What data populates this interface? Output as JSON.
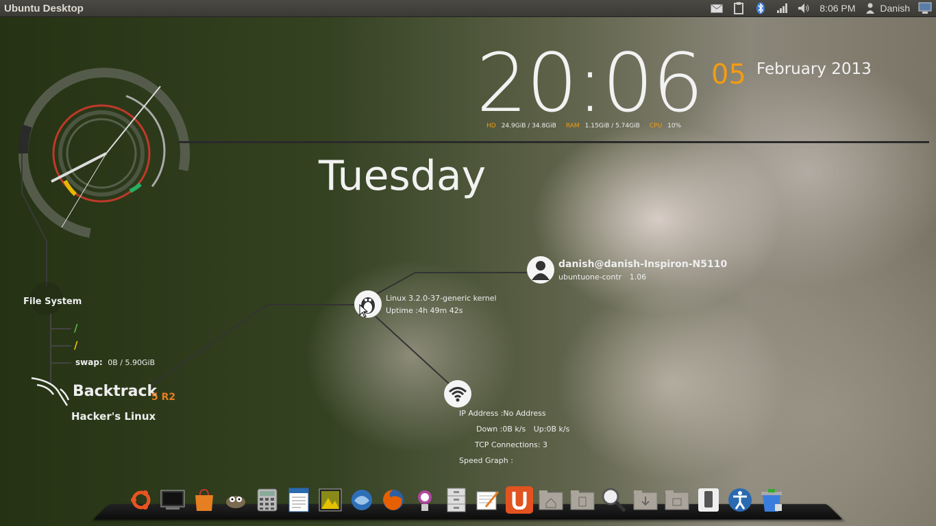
{
  "topbar": {
    "title": "Ubuntu Desktop",
    "time": "8:06 PM",
    "user": "Danish",
    "icons": [
      "mail-icon",
      "clipboard-icon",
      "bluetooth-icon",
      "network-signal-icon",
      "volume-icon",
      "user-icon",
      "system-gear-icon"
    ]
  },
  "clock": {
    "hm": "20:06",
    "seconds": "05",
    "date": "February 2013",
    "day": "Tuesday"
  },
  "stats": {
    "hd_label": "HD",
    "hd_value": "24.9GiB / 34.8GiB",
    "ram_label": "RAM",
    "ram_value": "1.15GiB / 5.74GiB",
    "cpu_label": "CPU",
    "cpu_value": "10%"
  },
  "user_node": {
    "name": "danish@danish-Inspiron-N5110",
    "process": "ubuntuone-contr",
    "process_value": "1.06"
  },
  "kernel_node": {
    "kernel": "Linux 3.2.0-37-generic kernel",
    "uptime": "Uptime :4h 49m 42s"
  },
  "network_node": {
    "ip": "IP Address :No Address",
    "down": "Down :0B k/s",
    "up": "Up:0B k/s",
    "tcp": "TCP Connections: 3",
    "graph": "Speed Graph :"
  },
  "filesystem": {
    "title": "File System",
    "root_slash": "/",
    "home_slash": "/",
    "swap_label": "swap:",
    "swap_value": "0B / 5.90GiB"
  },
  "branding": {
    "name": "Backtrack",
    "version": "5 R2",
    "tagline": "Hacker's Linux"
  },
  "colors": {
    "accent": "#f39c12",
    "text": "#f2f2f2",
    "panel": "#3b3a36"
  },
  "dock": {
    "items": [
      "ubuntu-logo-icon",
      "terminal-icon",
      "software-center-icon",
      "gimp-icon",
      "calculator-icon",
      "writer-icon",
      "image-viewer-icon",
      "thunderbird-icon",
      "firefox-icon",
      "mascot-icon",
      "file-cabinet-icon",
      "text-editor-icon",
      "ubuntu-one-icon",
      "home-folder-icon",
      "documents-folder-icon",
      "search-icon",
      "downloads-folder-icon",
      "drive-folder-icon",
      "phone-icon",
      "accessibility-icon",
      "trash-icon"
    ]
  }
}
